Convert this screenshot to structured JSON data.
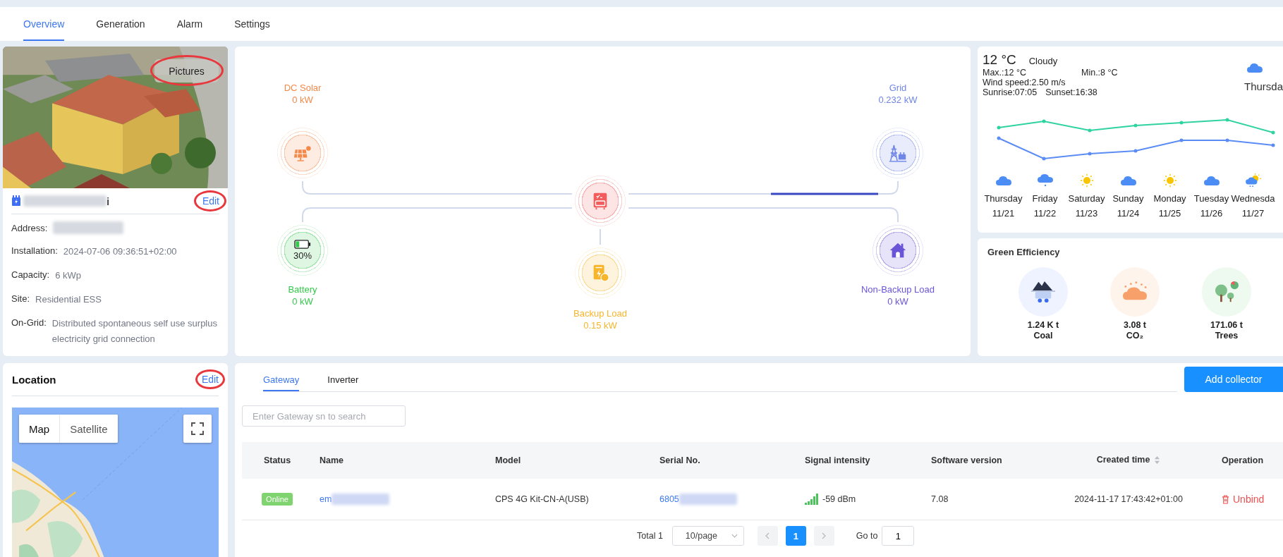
{
  "tabs": [
    {
      "label": "Overview",
      "selected": true
    },
    {
      "label": "Generation",
      "selected": false
    },
    {
      "label": "Alarm",
      "selected": false
    },
    {
      "label": "Settings",
      "selected": false
    }
  ],
  "plant": {
    "pictures_button": {
      "label": "Pictures",
      "highlighted": true
    },
    "name": {
      "text": "i",
      "redacted": true
    },
    "edit": {
      "label": "Edit",
      "highlighted": true
    },
    "fields": [
      {
        "label": "Address:",
        "kind": "blurred"
      },
      {
        "label": "Installation:",
        "value": "2024-07-06 09:36:51+02:00",
        "kind": "text"
      },
      {
        "label": "Capacity:",
        "value": "6 kWp",
        "kind": "text"
      },
      {
        "label": "Site:",
        "value": "Residential ESS",
        "kind": "text"
      },
      {
        "label": "On-Grid:",
        "value": "Distributed spontaneous self use surplus electricity grid connection",
        "kind": "text"
      }
    ]
  },
  "flow": {
    "grid_flow_active": true,
    "nodes": [
      {
        "kind": "solar",
        "label": "DC Solar",
        "value": "0 kW",
        "color": "#f5894a"
      },
      {
        "kind": "grid",
        "label": "Grid",
        "value": "0.232 kW",
        "color": "#6f86e6"
      },
      {
        "kind": "inverter",
        "color": "#f25c5c"
      },
      {
        "kind": "battery",
        "label": "Battery",
        "value": "0 kW",
        "percent": "30%",
        "level": 0.3,
        "color": "#33c94b"
      },
      {
        "kind": "backup",
        "label": "Backup Load",
        "value": "0.15 kW",
        "color": "#f7b52c"
      },
      {
        "kind": "nonbackup",
        "label": "Non-Backup Load",
        "value": "0 kW",
        "color": "#6a55d8"
      }
    ]
  },
  "weather": {
    "temperature": "12 °C",
    "condition": "Cloudy",
    "max": "Max.:12 °C",
    "min": "Min.:8 °C",
    "wind": "Wind speed:2.50 m/s",
    "sunrise": "Sunrise:07:05",
    "sunset": "Sunset:16:38",
    "today": {
      "kind": "cloudy",
      "day": "Thursda"
    },
    "days": [
      {
        "kind": "cloudy",
        "day": "Thursday",
        "date": "11/21"
      },
      {
        "kind": "rain",
        "day": "Friday",
        "date": "11/22"
      },
      {
        "kind": "sunny",
        "day": "Saturday",
        "date": "11/23"
      },
      {
        "kind": "cloudy",
        "day": "Sunday",
        "date": "11/24"
      },
      {
        "kind": "sunny",
        "day": "Monday",
        "date": "11/25"
      },
      {
        "kind": "cloudy",
        "day": "Tuesday",
        "date": "11/26"
      },
      {
        "kind": "partly",
        "day": "Wednesda",
        "date": "11/27"
      }
    ]
  },
  "green": {
    "title": "Green Efficiency",
    "items": [
      {
        "kind": "coal",
        "value": "1.24 K t",
        "label": "Coal"
      },
      {
        "kind": "co2",
        "value": "3.08 t",
        "label": "CO₂"
      },
      {
        "kind": "trees",
        "value": "171.06 t",
        "label": "Trees"
      }
    ]
  },
  "location": {
    "title": "Location",
    "edit": {
      "label": "Edit",
      "highlighted": true
    },
    "map_types": [
      {
        "label": "Map",
        "selected": true
      },
      {
        "label": "Satellite",
        "selected": false
      }
    ]
  },
  "devices": {
    "tabs": [
      {
        "label": "Gateway",
        "selected": true
      },
      {
        "label": "Inverter",
        "selected": false
      }
    ],
    "add_button": "Add collector",
    "search": {
      "placeholder": "Enter Gateway sn to search"
    },
    "columns": [
      {
        "label": "Status",
        "sortable": false
      },
      {
        "label": "Name",
        "sortable": false
      },
      {
        "label": "Model",
        "sortable": false
      },
      {
        "label": "Serial No.",
        "sortable": false
      },
      {
        "label": "Signal intensity",
        "sortable": false
      },
      {
        "label": "Software version",
        "sortable": false
      },
      {
        "label": "Created time",
        "sortable": true
      },
      {
        "label": "Operation",
        "sortable": false
      }
    ],
    "rows": [
      {
        "status": "Online",
        "name": {
          "text": "em",
          "redacted": true
        },
        "model": "CPS 4G Kit-CN-A(USB)",
        "serial": {
          "text": "6805",
          "redacted": true
        },
        "signal": "-59 dBm",
        "software": "7.08",
        "created": "2024-11-17 17:43:42+01:00",
        "action": "Unbind"
      }
    ],
    "pagination": {
      "total": "Total 1",
      "page_size": "10/page",
      "pages": [
        {
          "label": "1",
          "selected": true
        }
      ],
      "goto_label": "Go to",
      "goto_value": "1"
    }
  }
}
